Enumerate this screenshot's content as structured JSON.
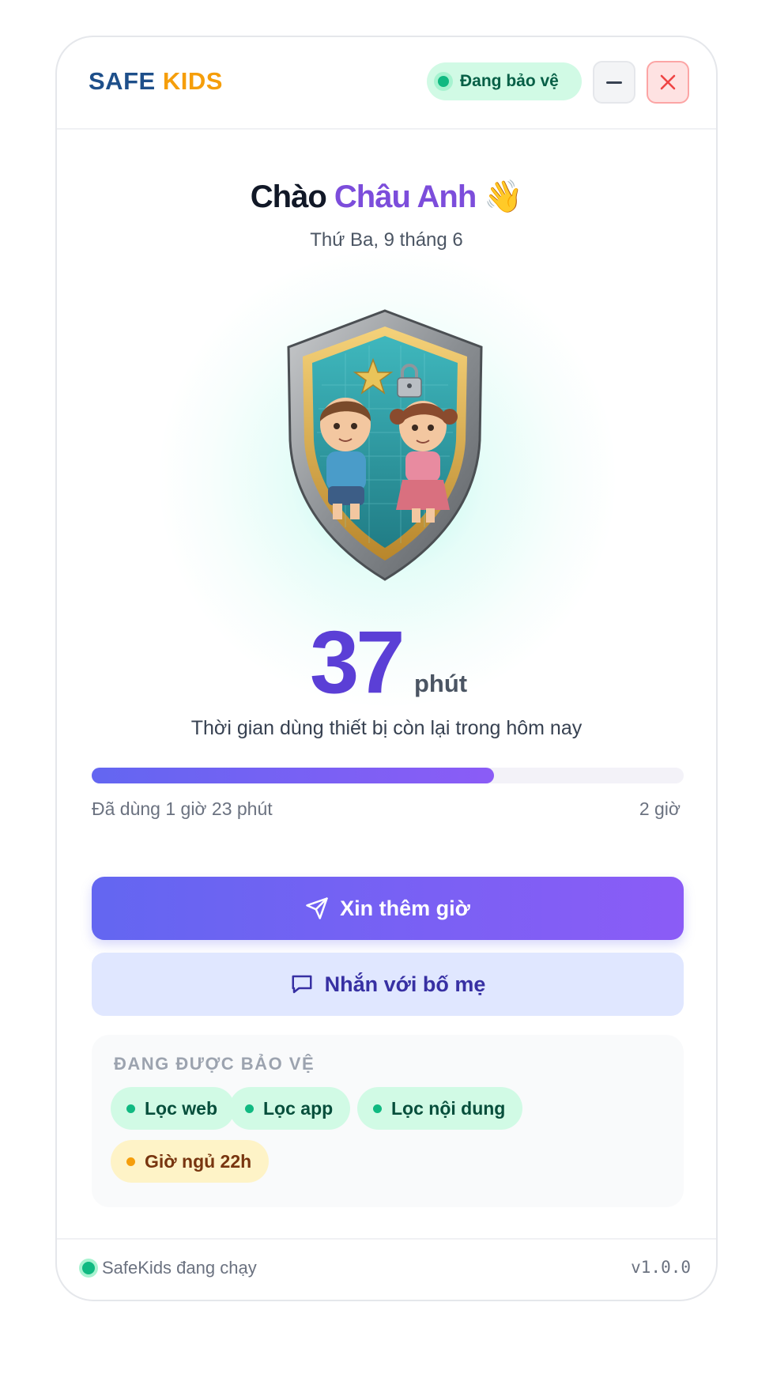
{
  "header": {
    "logo_safe": "SAFE",
    "logo_kids": "KIDS",
    "status_text": "Đang bảo vệ",
    "minimize_icon": "minus-icon",
    "close_icon": "close-icon"
  },
  "greeting": {
    "hello": "Chào",
    "name": "Châu Anh",
    "emoji": "👋",
    "date": "Thứ Ba, 9 tháng 6"
  },
  "time": {
    "remaining_value": "37",
    "remaining_unit": "phút",
    "remaining_label": "Thời gian dùng thiết bị còn lại trong hôm nay",
    "used_label": "Đã dùng 1 giờ 23 phút",
    "limit_label": "2 giờ",
    "used_fraction": 0.68
  },
  "actions": {
    "request_more": "Xin thêm giờ",
    "message_parents": "Nhắn với bố mẹ"
  },
  "protection": {
    "title": "ĐANG ĐƯỢC BẢO VỆ",
    "chips": [
      "Lọc web",
      "Lọc app",
      "Lọc nội dung",
      "Giờ ngủ 22h"
    ]
  },
  "footer": {
    "running_text": "SafeKids đang chạy",
    "version": "v1.0.0"
  },
  "colors": {
    "brand_navy": "#1e4f8a",
    "brand_orange": "#f59e0b",
    "accent_purple": "#6d4ee0",
    "status_green": "#10b981"
  }
}
